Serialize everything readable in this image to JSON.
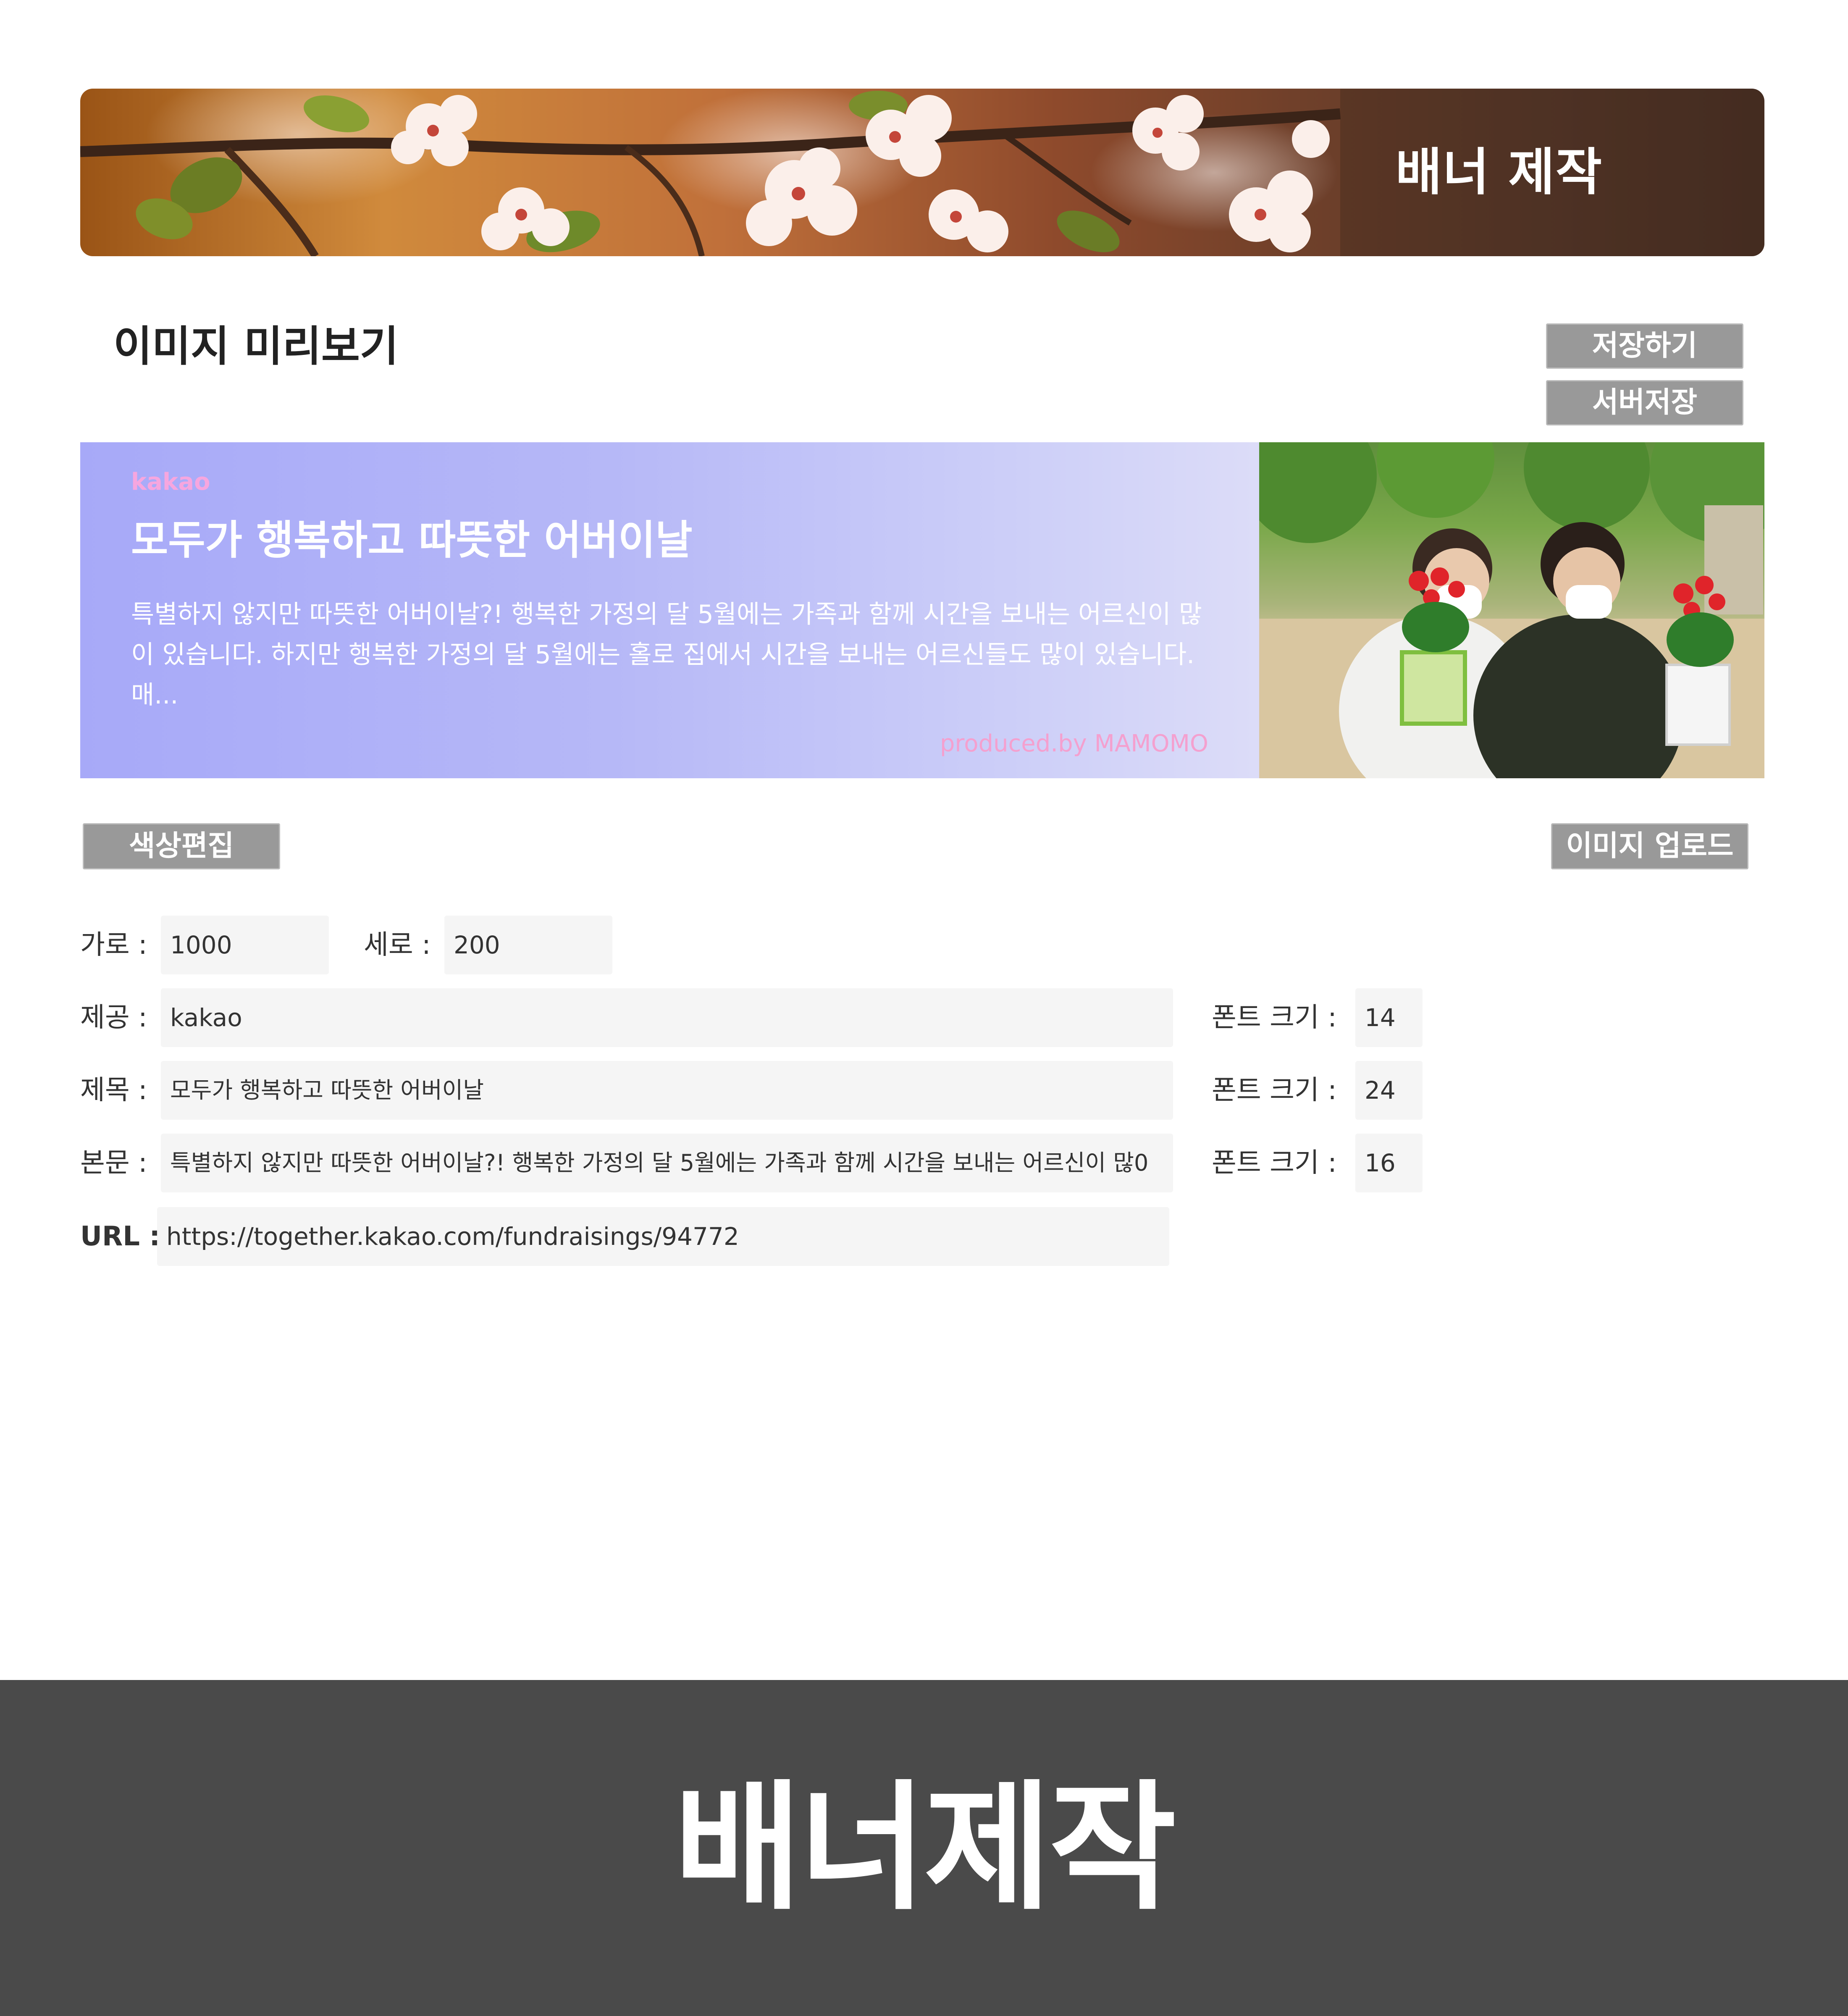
{
  "header": {
    "title": "배너 제작"
  },
  "preview_section": {
    "title": "이미지 미리보기",
    "save_label": "저장하기",
    "server_save_label": "서버저장"
  },
  "banner_preview": {
    "brand": "kakao",
    "title": "모두가 행복하고 따뜻한 어버이날",
    "body": "특별하지 않지만 따뜻한 어버이날?! 행복한 가정의 달 5월에는 가족과 함께 시간을 보내는 어르신이 많이 있습니다. 하지만 행복한 가정의 달 5월에는 홀로 집에서 시간을 보내는 어르신들도 많이 있습니다. 매...",
    "producer": "produced.by MAMOMO",
    "gradient_colors": [
      "#a7a9f8",
      "#dcdcf8"
    ]
  },
  "actions": {
    "color_edit_label": "색상편집",
    "image_upload_label": "이미지 업로드"
  },
  "form": {
    "width_label": "가로 :",
    "width_value": "1000",
    "height_label": "세로 :",
    "height_value": "200",
    "provider_label": "제공 :",
    "provider_value": "kakao",
    "provider_font_label": "폰트 크기 :",
    "provider_font_value": "14",
    "title_label": "제목 :",
    "title_value": "모두가 행복하고 따뜻한 어버이날",
    "title_font_label": "폰트 크기 :",
    "title_font_value": "24",
    "body_label": "본문 :",
    "body_value": "특별하지 않지만 따뜻한 어버이날?! 행복한 가정의 달 5월에는 가족과 함께 시간을 보내는 어르신이 많0",
    "body_font_label": "폰트 크기 :",
    "body_font_value": "16",
    "url_label": "URL :",
    "url_value": "https://together.kakao.com/fundraisings/94772"
  },
  "footer": {
    "title": "배너제작"
  },
  "colors": {
    "button_gray": "#999999",
    "footer_bg": "#4a4a4a",
    "brand_pink": "#f6a6df",
    "producer_pink": "#f4a0cf"
  }
}
